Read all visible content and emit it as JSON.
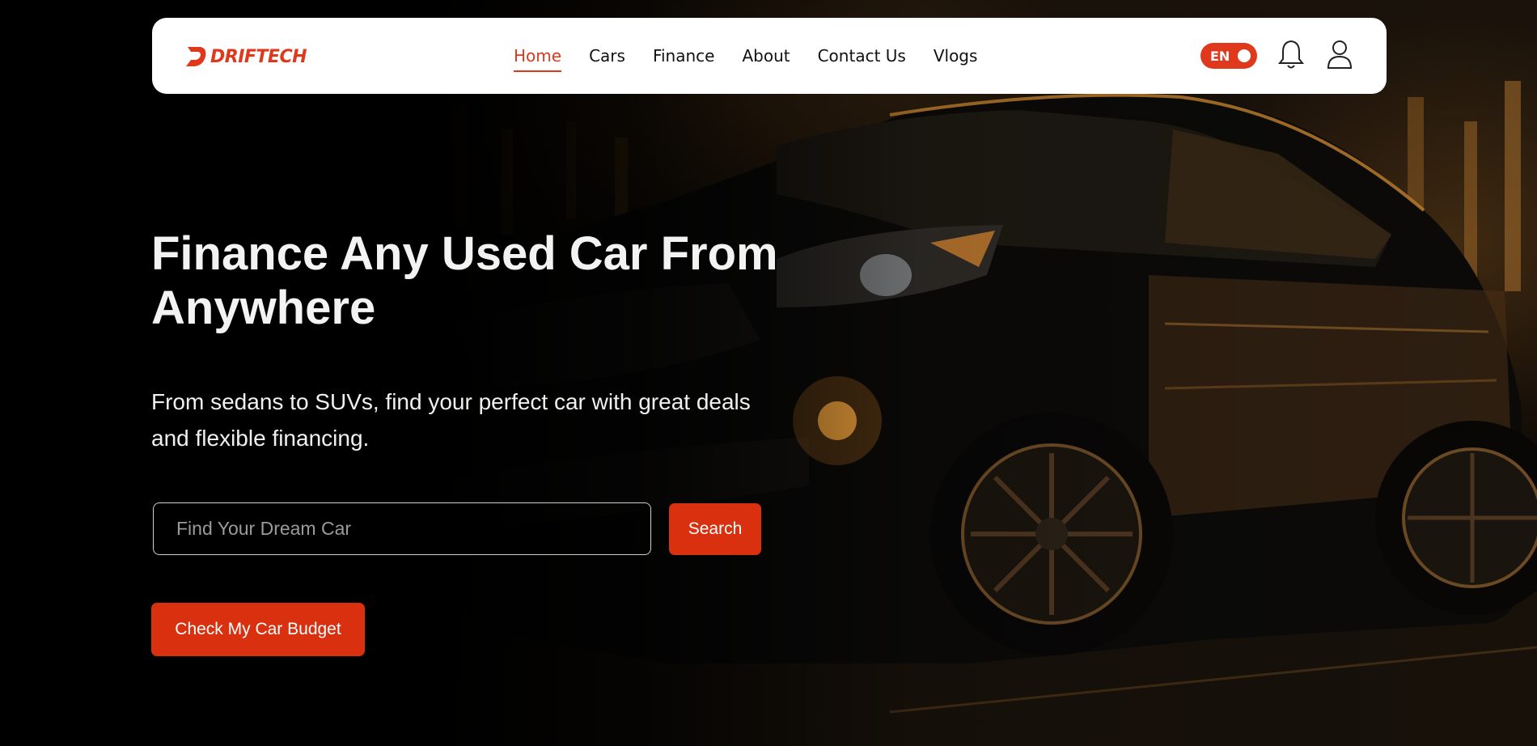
{
  "brand": {
    "name": "DRIFTECH",
    "accent": "#e0381c"
  },
  "nav": {
    "items": [
      {
        "label": "Home",
        "active": true
      },
      {
        "label": "Cars"
      },
      {
        "label": "Finance"
      },
      {
        "label": "About"
      },
      {
        "label": "Contact Us"
      },
      {
        "label": "Vlogs"
      }
    ],
    "language": "EN",
    "icons": [
      "bell-icon",
      "user-icon"
    ]
  },
  "hero": {
    "title_line1": "Finance Any Used Car From",
    "title_line2": "Anywhere",
    "subtitle_line1": "From sedans to SUVs, find your perfect car with great deals",
    "subtitle_line2": "and flexible financing.",
    "search": {
      "placeholder": "Find Your Dream Car",
      "button_label": "Search"
    },
    "cta_label": "Check My Car Budget"
  }
}
